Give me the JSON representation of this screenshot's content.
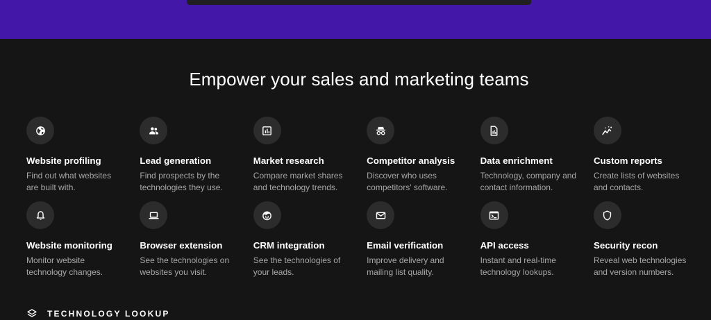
{
  "hero": {
    "bar_color": "#202020",
    "background": "#4318a8"
  },
  "section": {
    "title": "Empower your sales and marketing teams"
  },
  "features": [
    {
      "icon": "globe-icon",
      "title": "Website profiling",
      "desc": "Find out what websites are built with."
    },
    {
      "icon": "people-icon",
      "title": "Lead generation",
      "desc": "Find prospects by the technologies they use."
    },
    {
      "icon": "bar-chart-icon",
      "title": "Market research",
      "desc": "Compare market shares and technology trends."
    },
    {
      "icon": "spy-icon",
      "title": "Competitor analysis",
      "desc": "Discover who uses competitors' software."
    },
    {
      "icon": "document-chart-icon",
      "title": "Data enrichment",
      "desc": "Technology, company and contact information."
    },
    {
      "icon": "trend-icon",
      "title": "Custom reports",
      "desc": "Create lists of websites and contacts."
    },
    {
      "icon": "bell-icon",
      "title": "Website monitoring",
      "desc": "Monitor website technology changes."
    },
    {
      "icon": "laptop-icon",
      "title": "Browser extension",
      "desc": "See the technologies on websites you visit."
    },
    {
      "icon": "crm-face-icon",
      "title": "CRM integration",
      "desc": "See the technologies of your leads."
    },
    {
      "icon": "envelope-icon",
      "title": "Email verification",
      "desc": "Improve delivery and mailing list quality."
    },
    {
      "icon": "terminal-icon",
      "title": "API access",
      "desc": "Instant and real-time technology lookups."
    },
    {
      "icon": "shield-icon",
      "title": "Security recon",
      "desc": "Reveal web technologies and version numbers."
    }
  ],
  "bottom": {
    "icon": "layers-icon",
    "label": "TECHNOLOGY LOOKUP"
  }
}
